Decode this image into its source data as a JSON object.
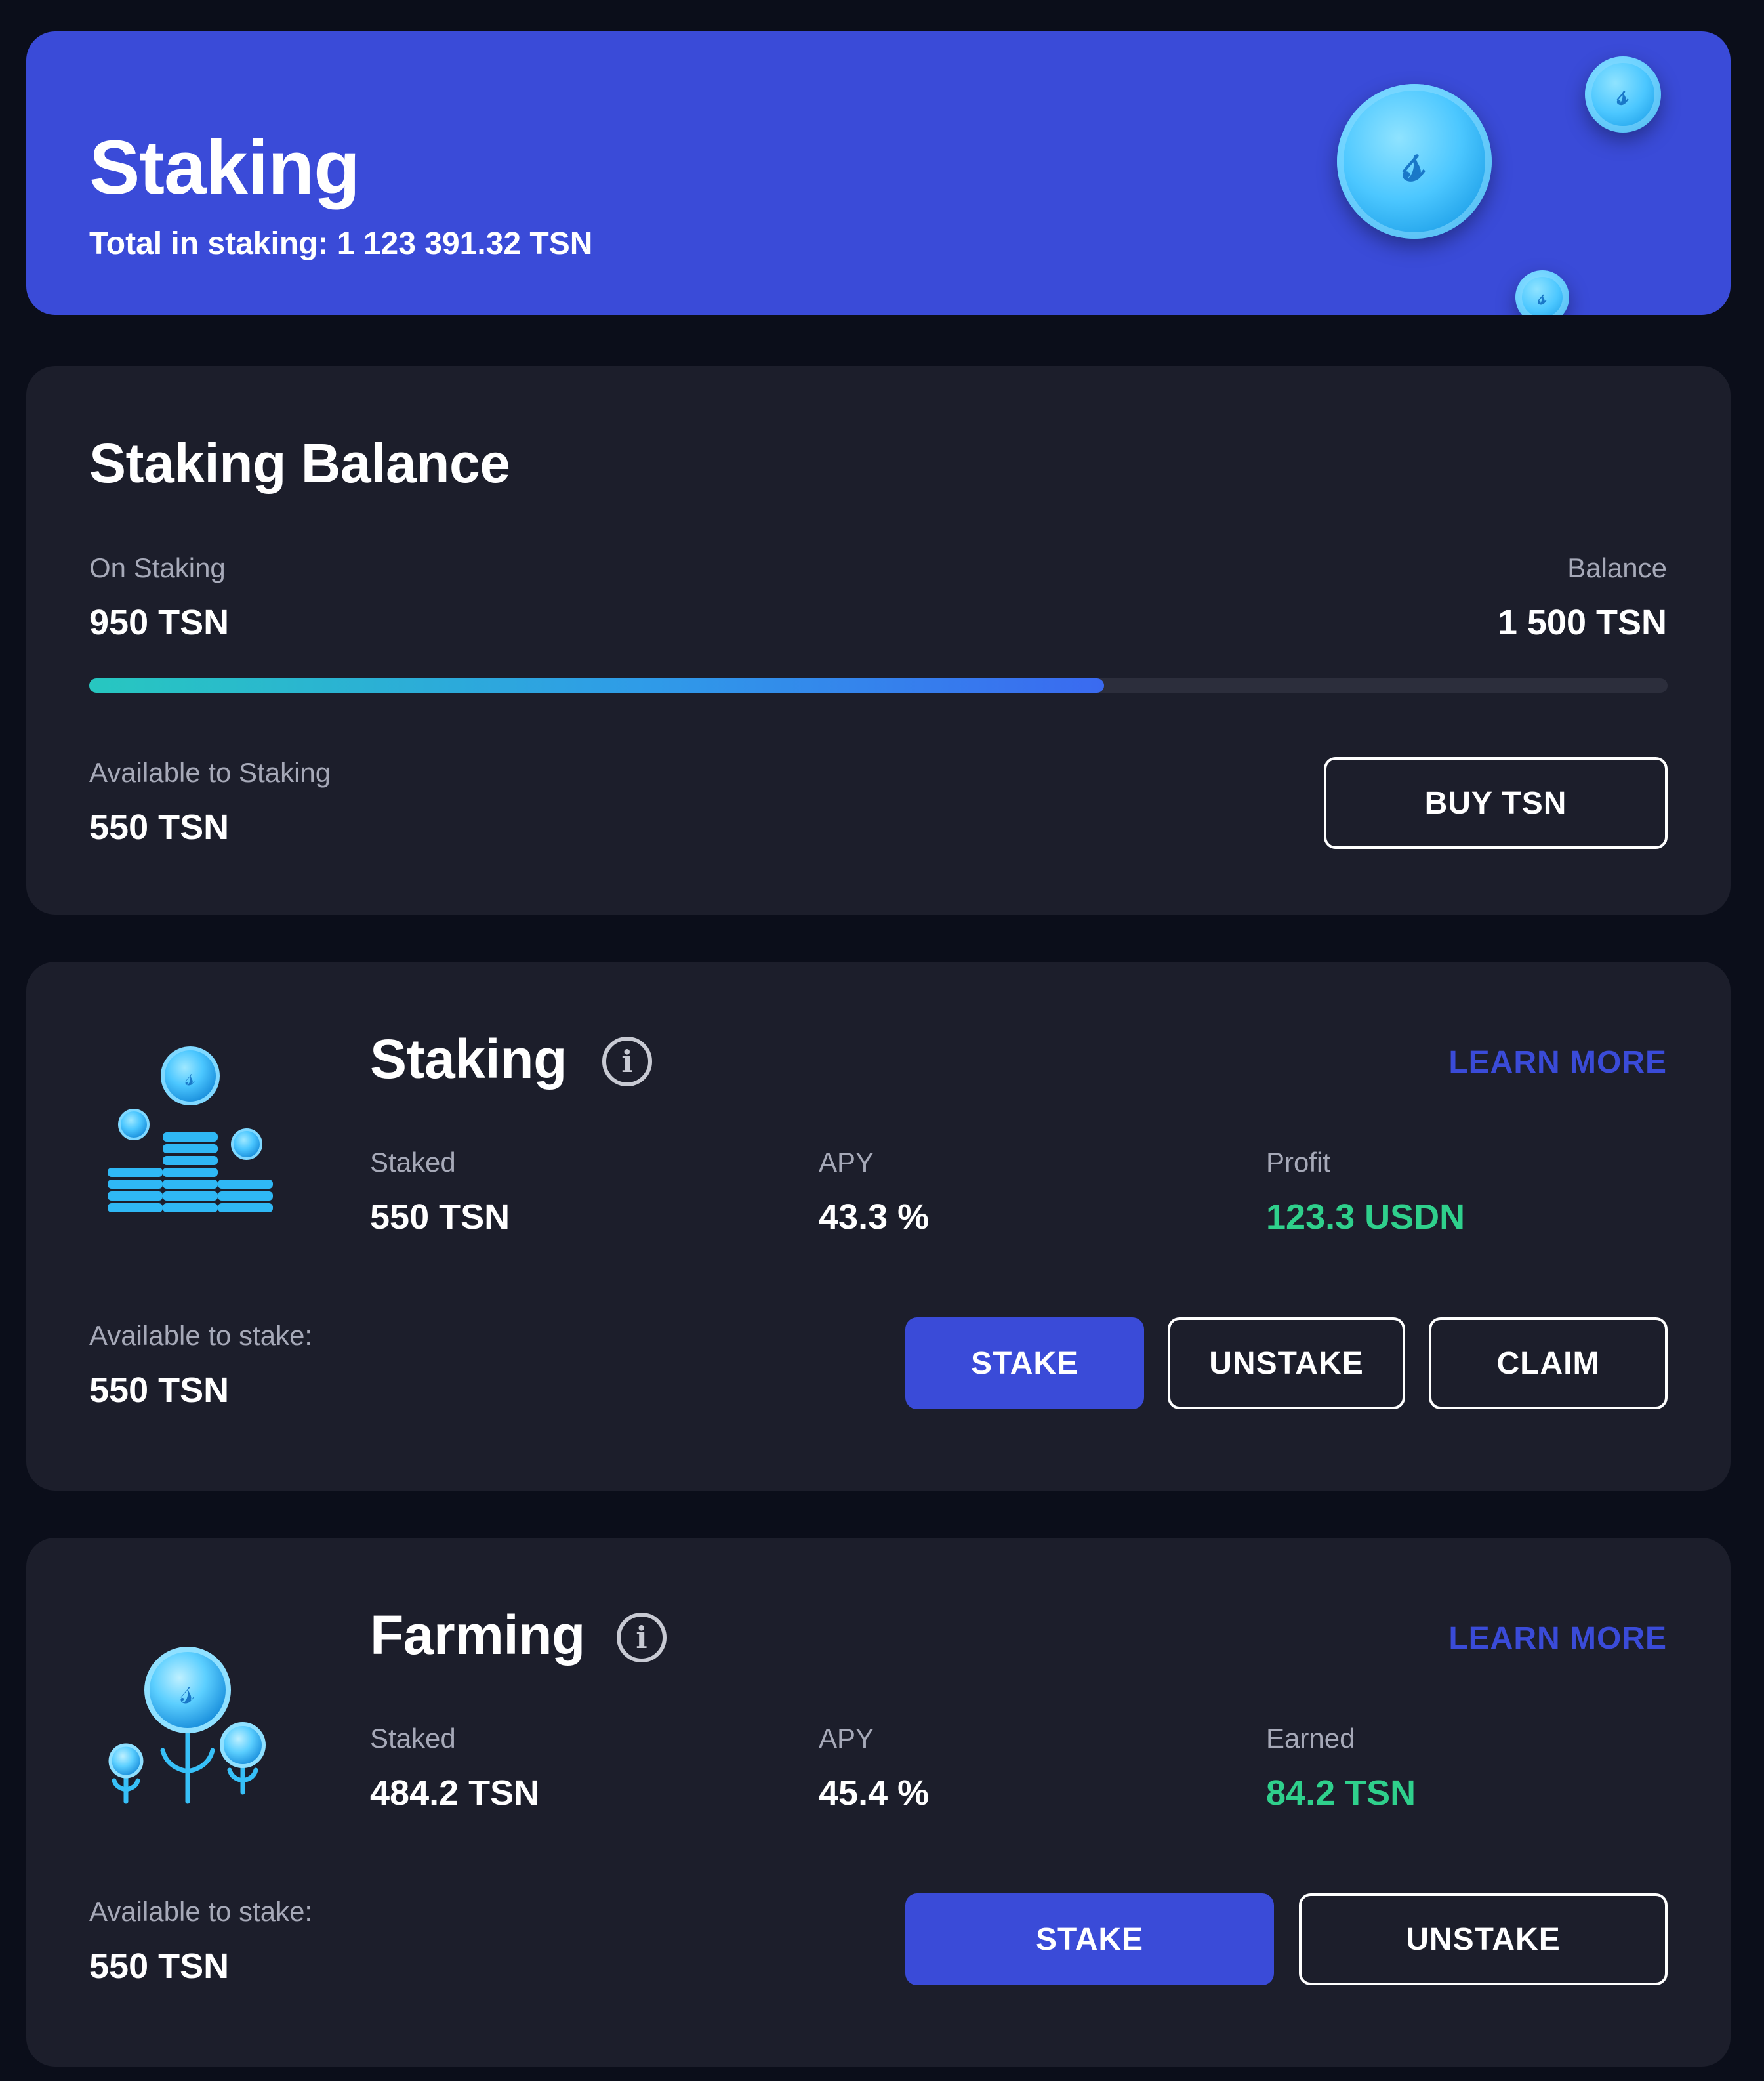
{
  "hero": {
    "title": "Staking",
    "total_label": "Total in staking: 1 123 391.32 TSN"
  },
  "balance": {
    "title": "Staking Balance",
    "on_staking_label": "On Staking",
    "on_staking_value": "950 TSN",
    "balance_label": "Balance",
    "balance_value": "1 500 TSN",
    "progress_fraction": 0.643,
    "available_label": "Available to Staking",
    "available_value": "550 TSN",
    "buy_button": "BUY TSN"
  },
  "staking": {
    "title": "Staking",
    "learn_more": "LEARN MORE",
    "staked_label": "Staked",
    "staked_value": "550 TSN",
    "apy_label": "APY",
    "apy_value": "43.3 %",
    "profit_label": "Profit",
    "profit_value": "123.3 USDN",
    "available_label": "Available to stake:",
    "available_value": "550 TSN",
    "stake_button": "STAKE",
    "unstake_button": "UNSTAKE",
    "claim_button": "CLAIM"
  },
  "farming": {
    "title": "Farming",
    "learn_more": "LEARN MORE",
    "staked_label": "Staked",
    "staked_value": "484.2 TSN",
    "apy_label": "APY",
    "apy_value": "45.4 %",
    "earned_label": "Earned",
    "earned_value": "84.2 TSN",
    "available_label": "Available to stake:",
    "available_value": "550 TSN",
    "stake_button": "STAKE",
    "unstake_button": "UNSTAKE"
  },
  "colors": {
    "background": "#0b0e1a",
    "card": "#1c1e2b",
    "accent": "#3a4bd8",
    "positive": "#2fd08c"
  },
  "icons": [
    "coin-icon",
    "coin-stack-icon",
    "plant-coins-icon",
    "info-icon"
  ]
}
